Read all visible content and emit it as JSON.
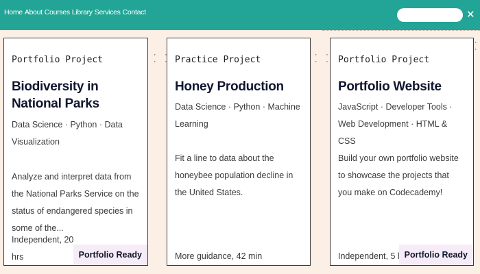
{
  "nav": {
    "links": [
      "Home",
      "About",
      "Courses",
      "Library",
      "Services",
      "Contact"
    ],
    "search_value": "",
    "close_glyph": "✕"
  },
  "cards": [
    {
      "type": "Portfolio Project",
      "title": "Biodiversity in National Parks",
      "tags": "Data Science · Python · Data Visualization",
      "description": "Analyze and interpret data from the National Parks Service on the status of endangered species in some of the...",
      "meta": "Independent, 20 hrs",
      "badge": "Portfolio Ready"
    },
    {
      "type": "Practice Project",
      "title": "Honey Production",
      "tags": "Data Science · Python · Machine Learning",
      "description": "Fit a line to data about the honeybee population decline in the United States.",
      "meta": "More guidance, 42 min",
      "badge": ""
    },
    {
      "type": "Portfolio Project",
      "title": "Portfolio Website",
      "tags": "JavaScript · Developer Tools · Web Development · HTML & CSS",
      "description": "Build your own portfolio website to showcase the projects that you make on Codecademy!",
      "meta": "Independent, 5 hrs",
      "badge": "Portfolio Ready"
    }
  ],
  "colors": {
    "navbar": "#22a596",
    "background": "#fcefe6",
    "badge_bg": "#f6ecf7",
    "title": "#10162f"
  }
}
